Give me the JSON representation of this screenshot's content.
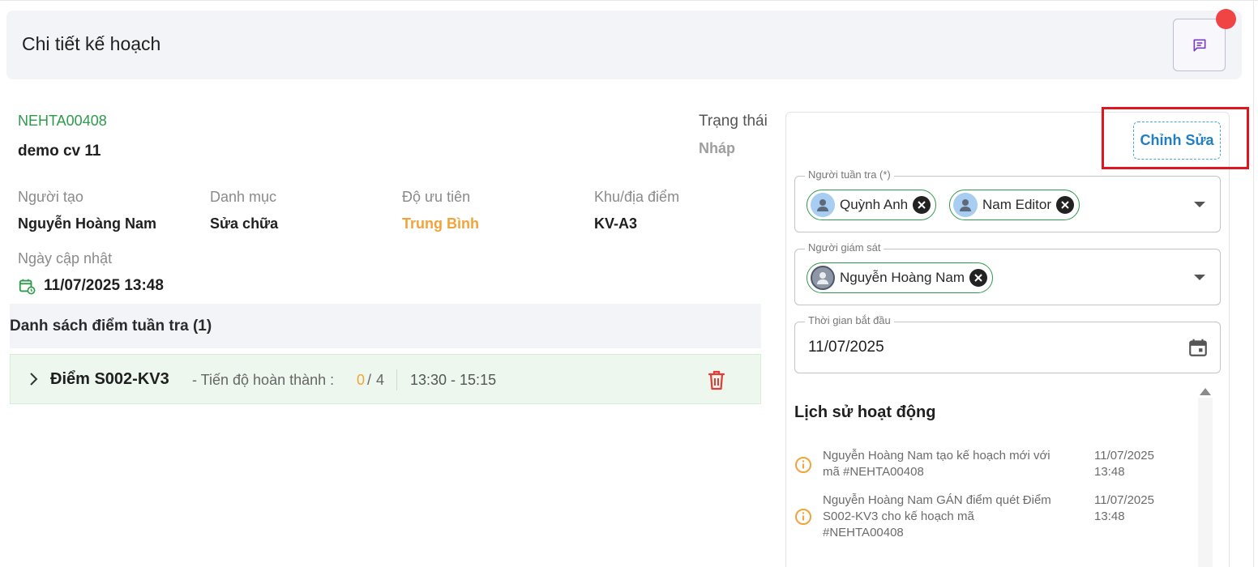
{
  "header": {
    "title": "Chi tiết kế hoạch"
  },
  "plan": {
    "code": "NEHTA00408",
    "name": "demo cv 11",
    "status_label": "Trạng thái",
    "status_value": "Nháp",
    "creator_label": "Người tạo",
    "creator_value": "Nguyễn Hoàng Nam",
    "category_label": "Danh mục",
    "category_value": "Sửa chữa",
    "priority_label": "Độ ưu tiên",
    "priority_value": "Trung Bình",
    "location_label": "Khu/địa điểm",
    "location_value": "KV-A3",
    "updated_label": "Ngày cập nhật",
    "updated_value": "11/07/2025 13:48"
  },
  "points": {
    "title": "Danh sách điểm tuần tra (1)",
    "items": [
      {
        "name": "Điểm S002-KV3",
        "progress_label": "- Tiến độ hoàn thành :",
        "done": "0",
        "sep": "/",
        "total": "4",
        "time": "13:30 - 15:15"
      }
    ]
  },
  "panel": {
    "edit_label": "Chỉnh Sửa",
    "patrol_label": "Người tuần tra (*)",
    "patrollers": [
      "Quỳnh Anh",
      "Nam Editor"
    ],
    "supervisor_label": "Người giám sát",
    "supervisors": [
      "Nguyễn Hoàng Nam"
    ],
    "start_label": "Thời gian bắt đầu",
    "start_value": "11/07/2025"
  },
  "history": {
    "title": "Lịch sử hoạt động",
    "items": [
      {
        "line1": "Nguyễn Hoàng Nam tạo kế hoạch mới với",
        "line2": "mã #NEHTA00408",
        "line3": "",
        "date": "11/07/2025",
        "time": "13:48"
      },
      {
        "line1": "Nguyễn Hoàng Nam GÁN điểm quét Điểm",
        "line2": "S002-KV3 cho kế hoạch mã",
        "line3": "#NEHTA00408",
        "date": "11/07/2025",
        "time": "13:48"
      }
    ]
  },
  "colors": {
    "accent_green": "#2e9a4c",
    "priority_orange": "#f2a33a",
    "link_blue": "#1f7ec4",
    "highlight_red": "#e0161e",
    "delete_red": "#e53935"
  }
}
